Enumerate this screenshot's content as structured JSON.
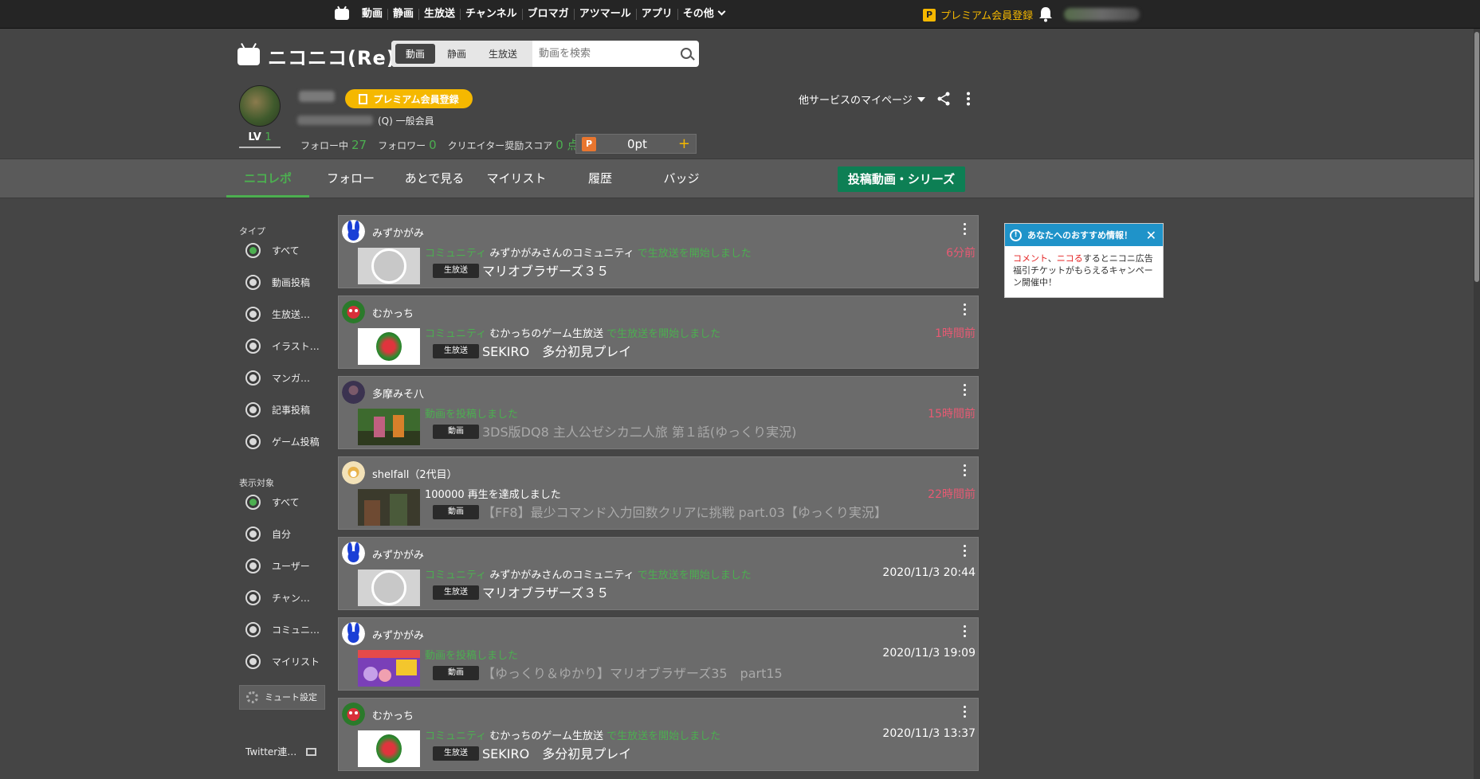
{
  "topbar": {
    "nav": [
      "動画",
      "静画",
      "生放送",
      "チャンネル",
      "ブロマガ",
      "アツマール",
      "アプリ",
      "その他"
    ],
    "premium_label": "プレミアム会員登録",
    "premium_badge": "P"
  },
  "header": {
    "logo_text": "ニコニコ(Re)",
    "search_tabs": [
      "動画",
      "静画",
      "生放送"
    ],
    "search_placeholder": "動画を検索"
  },
  "profile": {
    "lv_label": "LV",
    "lv_value": "1",
    "premium_button": "プレミアム会員登録",
    "member_text": "(Q) 一般会員",
    "follow_label": "フォロー中",
    "follow_count": "27",
    "follower_label": "フォロワー",
    "follower_count": "0",
    "score_label": "クリエイター奨励スコア",
    "score_value": "0 点",
    "points_badge": "P",
    "points_value": "0pt",
    "points_plus": "+",
    "other_mypage": "他サービスのマイページ"
  },
  "tabs": [
    {
      "label": "ニコレポ"
    },
    {
      "label": "フォロー"
    },
    {
      "label": "あとで見る"
    },
    {
      "label": "マイリスト"
    },
    {
      "label": "履歴"
    },
    {
      "label": "バッジ"
    }
  ],
  "series_button": "投稿動画・シリーズ",
  "sidebar": {
    "type_title": "タイプ",
    "type_options": [
      "すべて",
      "動画投稿",
      "生放送…",
      "イラスト…",
      "マンガ…",
      "記事投稿",
      "ゲーム投稿"
    ],
    "target_title": "表示対象",
    "target_options": [
      "すべて",
      "自分",
      "ユーザー",
      "チャン…",
      "コミュニ…",
      "マイリスト"
    ],
    "mute_label": "ミュート設定",
    "twitter_label": "Twitter連…"
  },
  "feed": [
    {
      "user": "みずかがみ",
      "prefix": "コミュニティ",
      "subject": "みずかがみさんのコミュニティ",
      "action": "で生放送を開始しました",
      "time": "6分前",
      "badge": "生放送",
      "title": "マリオブラザーズ３５"
    },
    {
      "user": "むかっち",
      "prefix": "コミュニティ",
      "subject": "むかっちのゲーム生放送",
      "action": "で生放送を開始しました",
      "time": "1時間前",
      "badge": "生放送",
      "title": "SEKIRO　多分初見プレイ"
    },
    {
      "user": "多摩みそ八",
      "prefix": "",
      "subject": "",
      "action": "動画を投稿しました",
      "time": "15時間前",
      "badge": "動画",
      "title": "3DS版DQ8 主人公ゼシカ二人旅 第１話(ゆっくり実況)"
    },
    {
      "user": "shelfall（2代目）",
      "prefix": "",
      "subject": "100000 再生を達成しました",
      "action": "",
      "time": "22時間前",
      "badge": "動画",
      "title": "【FF8】最少コマンド入力回数クリアに挑戦 part.03【ゆっくり実況】"
    },
    {
      "user": "みずかがみ",
      "prefix": "コミュニティ",
      "subject": "みずかがみさんのコミュニティ",
      "action": "で生放送を開始しました",
      "time": "2020/11/3 20:44",
      "badge": "生放送",
      "title": "マリオブラザーズ３５"
    },
    {
      "user": "みずかがみ",
      "prefix": "",
      "subject": "",
      "action": "動画を投稿しました",
      "time": "2020/11/3 19:09",
      "badge": "動画",
      "title": "【ゆっくり＆ゆかり】マリオブラザーズ35　part15"
    },
    {
      "user": "むかっち",
      "prefix": "コミュニティ",
      "subject": "むかっちのゲーム生放送",
      "action": "で生放送を開始しました",
      "time": "2020/11/3 13:37",
      "badge": "生放送",
      "title": "SEKIRO　多分初見プレイ"
    }
  ],
  "notice": {
    "title": "あなたへのおすすめ情報！",
    "body_red1": "コメント",
    "body_sep": "、",
    "body_red2": "ニコる",
    "body_rest": "するとニコニ広告 福引チケットがもらえるキャンペーン開催中！"
  }
}
